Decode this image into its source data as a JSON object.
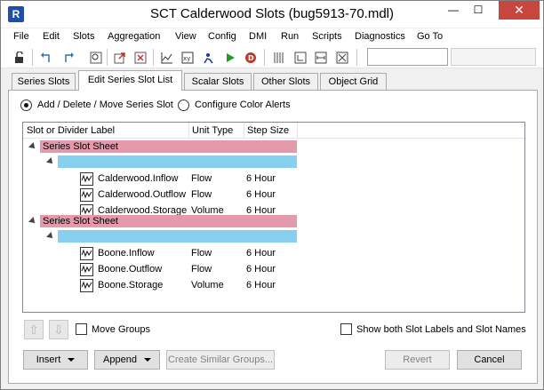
{
  "window": {
    "title": "SCT Calderwood Slots (bug5913-70.mdl)",
    "app_icon_letter": "R",
    "min_glyph": "—",
    "max_glyph": "☐",
    "close_glyph": "✕"
  },
  "menu": [
    "File",
    "Edit",
    "Slots",
    "Aggregation",
    "View",
    "Config",
    "DMI",
    "Run",
    "Scripts",
    "Diagnostics",
    "Go To"
  ],
  "toolbar": {
    "icons": [
      "lock-icon",
      "undo-icon",
      "redo-icon",
      "zoom-icon",
      "export-icon",
      "close-slot-icon",
      "plot-icon",
      "xy-icon",
      "dispatch-icon",
      "runner-icon",
      "play-icon",
      "stop-icon",
      "columns-icon",
      "timestep-icon",
      "range-icon",
      "fit-icon"
    ],
    "input_value": ""
  },
  "tabs": [
    "Series Slots",
    "Edit Series Slot List",
    "Scalar Slots",
    "Other Slots",
    "Object Grid"
  ],
  "active_tab": 1,
  "mode": {
    "option1": "Add / Delete / Move Series Slot",
    "option2": "Configure Color Alerts",
    "selected": 1
  },
  "tree": {
    "headers": {
      "label": "Slot or Divider Label",
      "unit": "Unit Type",
      "step": "Step Size"
    },
    "colors": {
      "sheet": "#e59aac",
      "divider": "#86cfee"
    },
    "groups": [
      {
        "sheet_label": "Series Slot Sheet",
        "slots": [
          {
            "name": "Calderwood.Inflow",
            "unit": "Flow",
            "step": "6 Hour"
          },
          {
            "name": "Calderwood.Outflow",
            "unit": "Flow",
            "step": "6 Hour"
          },
          {
            "name": "Calderwood.Storage",
            "unit": "Volume",
            "step": "6 Hour"
          }
        ]
      },
      {
        "sheet_label": "Series Slot Sheet",
        "slots": [
          {
            "name": "Boone.Inflow",
            "unit": "Flow",
            "step": "6 Hour"
          },
          {
            "name": "Boone.Outflow",
            "unit": "Flow",
            "step": "6 Hour"
          },
          {
            "name": "Boone.Storage",
            "unit": "Volume",
            "step": "6 Hour"
          }
        ]
      }
    ]
  },
  "bottom": {
    "move_groups": "Move Groups",
    "show_both": "Show both Slot Labels and Slot Names",
    "up_glyph": "⇧",
    "down_glyph": "⇩",
    "insert": "Insert",
    "append": "Append",
    "create_similar": "Create Similar Groups...",
    "revert": "Revert",
    "cancel": "Cancel"
  }
}
